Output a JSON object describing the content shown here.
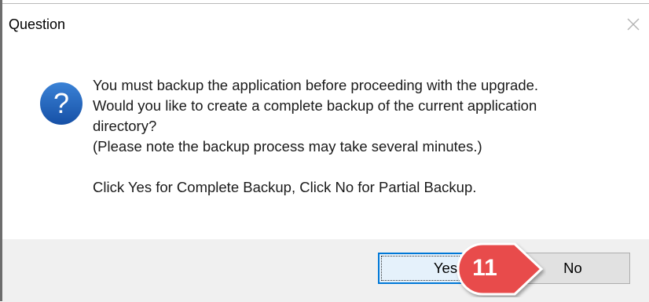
{
  "dialog": {
    "title": "Question",
    "message_lines": [
      "You must backup the application before proceeding with the upgrade.",
      "Would you like to create a complete backup of the current application",
      "directory?",
      "(Please note the backup process may take several minutes.)",
      "Click Yes for Complete Backup, Click No for Partial Backup."
    ],
    "buttons": {
      "yes_label": "Yes",
      "no_label": "No"
    }
  },
  "annotation": {
    "step_number": "11",
    "color": "#e84c4c"
  },
  "colors": {
    "question_icon": "#1f5fb4",
    "focus_border": "#0078d7",
    "footer_bg": "#f0f0f0"
  },
  "icons": {
    "close": "close-icon",
    "question": "question-icon"
  }
}
